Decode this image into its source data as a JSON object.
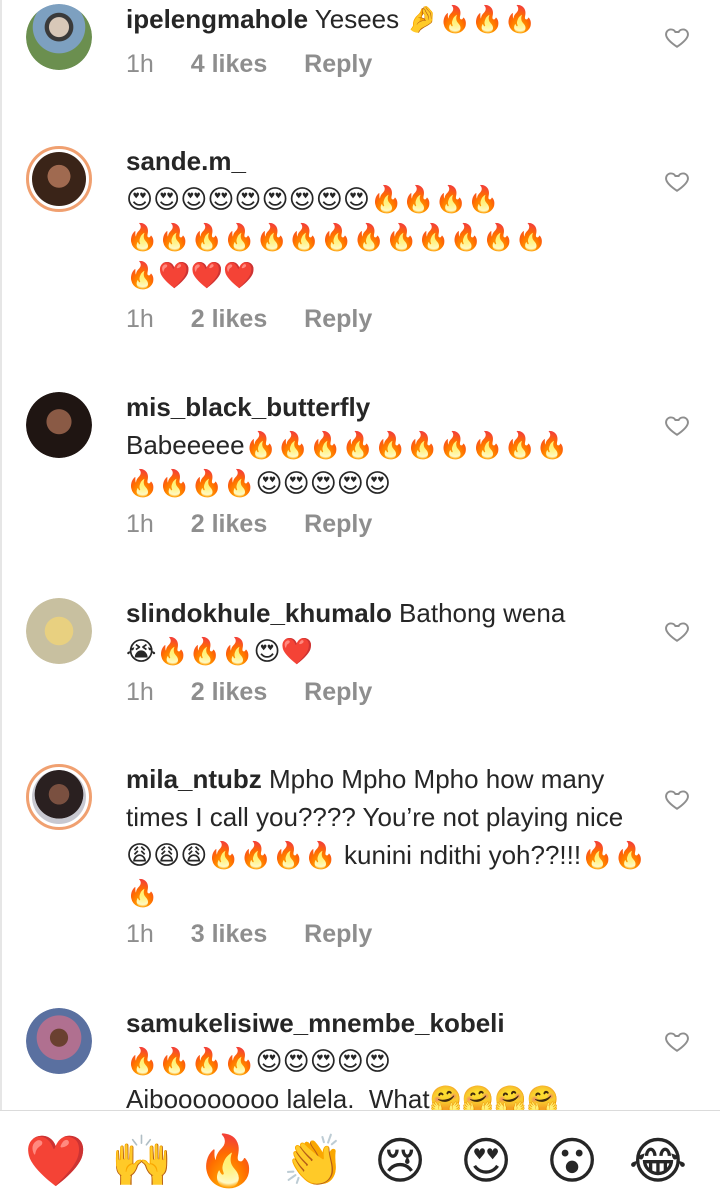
{
  "comments": [
    {
      "username": "ipelengmahole",
      "text": " Yesees 🤌🔥🔥🔥",
      "time": "1h",
      "likes": "4 likes",
      "reply": "Reply",
      "ring": false,
      "avatar_color": "#5f7f55"
    },
    {
      "username": "sande.m_",
      "text": "\n😍😍😍😍😍😍😍😍😍🔥🔥🔥🔥\n🔥🔥🔥🔥🔥🔥🔥🔥🔥🔥🔥🔥🔥\n🔥❤️❤️❤️",
      "time": "1h",
      "likes": "2 likes",
      "reply": "Reply",
      "ring": true,
      "avatar_color": "#5a3a2c"
    },
    {
      "username": "mis_black_butterfly",
      "text": "\nBabeeeee🔥🔥🔥🔥🔥🔥🔥🔥🔥🔥\n🔥🔥🔥🔥😍😍😍😍😍",
      "time": "1h",
      "likes": "2 likes",
      "reply": "Reply",
      "ring": false,
      "avatar_color": "#3b2520"
    },
    {
      "username": "slindokhule_khumalo",
      "text": " Bathong wena\n😭🔥🔥🔥😍❤️",
      "time": "1h",
      "likes": "2 likes",
      "reply": "Reply",
      "ring": false,
      "avatar_color": "#d9cf9a"
    },
    {
      "username": "mila_ntubz",
      "text": " Mpho Mpho Mpho how many times I call you???? You’re not playing nice😩😩😩🔥🔥🔥🔥 kunini ndithi yoh??!!!🔥🔥🔥",
      "time": "1h",
      "likes": "3 likes",
      "reply": "Reply",
      "ring": true,
      "avatar_color": "#4a3a36"
    },
    {
      "username": "samukelisiwe_mnembe_kobeli",
      "text": "\n🔥🔥🔥🔥😍😍😍😍😍\nAiboooooooo lalela.  What🤗🤗🤗🤗",
      "time": "",
      "likes": "",
      "reply": "",
      "ring": false,
      "avatar_color": "#8a6a80"
    }
  ],
  "reactions": [
    "❤️",
    "🙌",
    "🔥",
    "👏",
    "😢",
    "😍",
    "😮",
    "😂"
  ],
  "colors": {
    "meta": "#8e8e8e",
    "ring": "#f0a070"
  }
}
